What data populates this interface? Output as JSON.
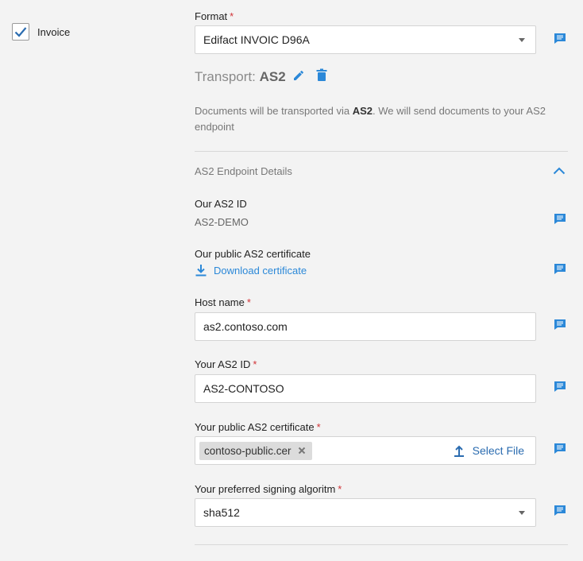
{
  "document": {
    "type_label": "Invoice",
    "checked": true
  },
  "format": {
    "label": "Format",
    "value": "Edifact INVOIC D96A"
  },
  "transport": {
    "prefix": "Transport:",
    "name": "AS2",
    "desc_start": "Documents will be transported via ",
    "desc_bold": "AS2",
    "desc_end": ". We will send documents to your AS2 endpoint"
  },
  "section": {
    "title": "AS2 Endpoint Details"
  },
  "our_id": {
    "label": "Our AS2 ID",
    "value": "AS2-DEMO"
  },
  "our_cert": {
    "label": "Our public AS2 certificate",
    "link": "Download certificate"
  },
  "host": {
    "label": "Host name",
    "value": "as2.contoso.com"
  },
  "your_id": {
    "label": "Your AS2 ID",
    "value": "AS2-CONTOSO"
  },
  "your_cert": {
    "label": "Your public AS2 certificate",
    "file": "contoso-public.cer",
    "select_label": "Select File"
  },
  "signing": {
    "label": "Your preferred signing algoritm",
    "value": "sha512"
  },
  "icons": [
    "check-icon",
    "chevron-down-icon",
    "edit-pencil-icon",
    "trash-icon",
    "chevron-up-icon",
    "download-icon",
    "upload-icon",
    "close-icon",
    "comment-icon"
  ],
  "colors": {
    "accent": "#2b88d8",
    "required": "#d13438",
    "background": "#f3f3f3"
  }
}
